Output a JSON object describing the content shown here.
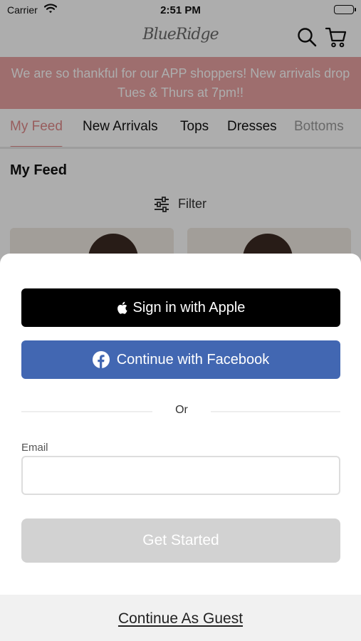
{
  "status_bar": {
    "carrier": "Carrier",
    "time": "2:51 PM"
  },
  "header": {
    "logo_text": "BlueRidge"
  },
  "banner": {
    "text": "We are so thankful for our APP shoppers! New arrivals drop Tues & Thurs at 7pm!!"
  },
  "tabs": [
    {
      "label": "My Feed",
      "active": true
    },
    {
      "label": "New Arrivals"
    },
    {
      "label": "Tops"
    },
    {
      "label": "Dresses"
    },
    {
      "label": "Bottoms"
    }
  ],
  "feed": {
    "title": "My Feed",
    "filter_label": "Filter"
  },
  "login_sheet": {
    "apple_label": "Sign in with Apple",
    "facebook_label": "Continue with Facebook",
    "divider_text": "Or",
    "email_label": "Email",
    "email_value": "",
    "email_placeholder": "",
    "submit_label": "Get Started",
    "guest_label": "Continue As Guest"
  },
  "colors": {
    "banner_bg": "#e9a3a3",
    "accent": "#e08a8a",
    "apple_bg": "#000000",
    "facebook_bg": "#4267b2",
    "disabled_button": "#d2d2d2"
  },
  "icons": {
    "wifi": "wifi-icon",
    "battery": "battery-icon",
    "search": "search-icon",
    "cart": "cart-icon",
    "filter": "sliders-icon",
    "apple": "apple-logo-icon",
    "facebook": "facebook-logo-icon"
  }
}
